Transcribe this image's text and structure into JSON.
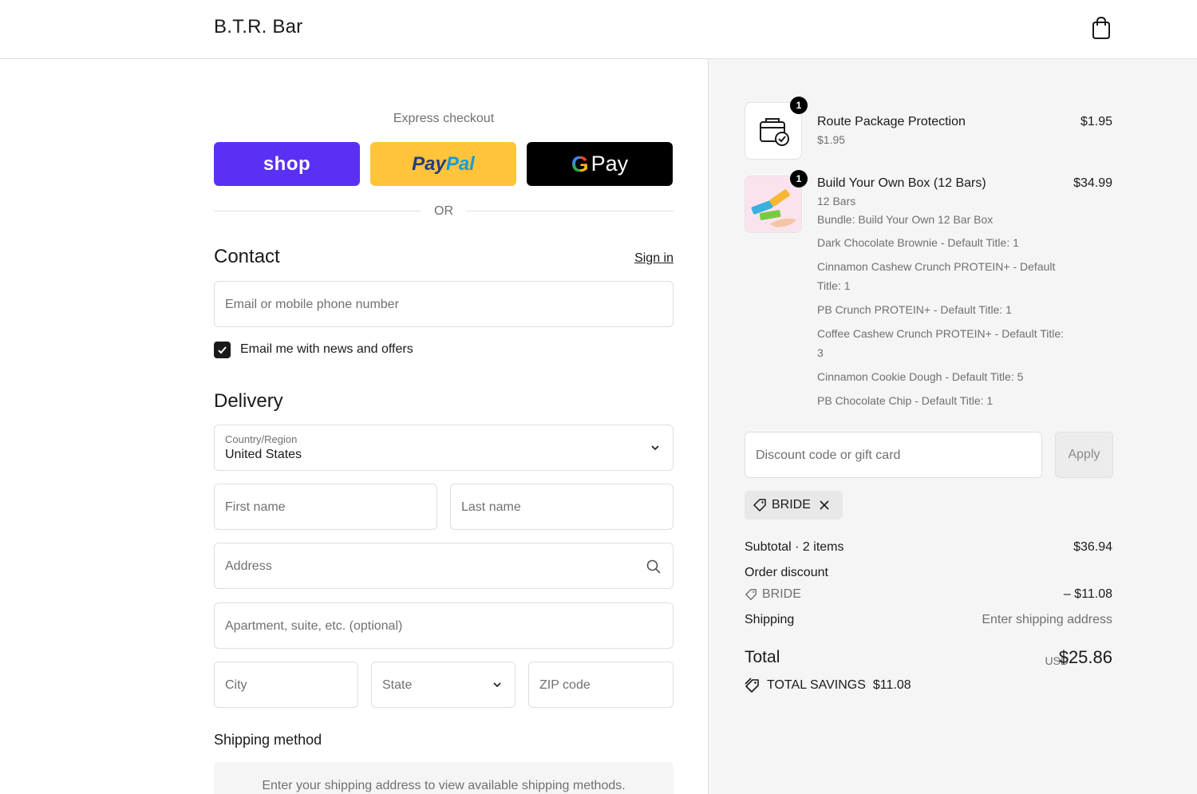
{
  "header": {
    "brand": "B.T.R. Bar",
    "bag_icon": "shopping-bag-icon"
  },
  "express": {
    "title": "Express checkout",
    "shop_label": "shop",
    "paypal_part1": "Pay",
    "paypal_part2": "Pal",
    "gpay_g": "G",
    "gpay_label": "Pay",
    "or_label": "OR"
  },
  "contact": {
    "title": "Contact",
    "sign_in": "Sign in",
    "email_placeholder": "Email or mobile phone number",
    "newsletter_label": "Email me with news and offers",
    "newsletter_checked": true
  },
  "delivery": {
    "title": "Delivery",
    "country_label": "Country/Region",
    "country_value": "United States",
    "first_name_placeholder": "First name",
    "last_name_placeholder": "Last name",
    "address_placeholder": "Address",
    "apartment_placeholder": "Apartment, suite, etc. (optional)",
    "city_placeholder": "City",
    "state_placeholder": "State",
    "zip_placeholder": "ZIP code"
  },
  "shipping_method": {
    "title": "Shipping method",
    "message": "Enter your shipping address to view available shipping methods."
  },
  "summary": {
    "items": [
      {
        "qty": "1",
        "title": "Route Package Protection",
        "subtitle": "$1.95",
        "price": "$1.95",
        "icon": "package-protection-icon"
      },
      {
        "qty": "1",
        "title": "Build Your Own Box (12 Bars)",
        "price": "$34.99",
        "icon": "protein-bars-image",
        "lines": [
          "12 Bars",
          "Bundle: Build Your Own 12 Bar Box",
          "Dark Chocolate Brownie - Default Title: 1",
          "Cinnamon Cashew Crunch PROTEIN+ - Default",
          "Title: 1",
          "PB Crunch PROTEIN+ - Default Title: 1",
          "Coffee Cashew Crunch PROTEIN+ - Default Title:",
          "3",
          "Cinnamon Cookie Dough - Default Title: 5",
          "PB Chocolate Chip - Default Title: 1"
        ]
      }
    ],
    "discount_placeholder": "Discount code or gift card",
    "apply_label": "Apply",
    "applied_code": "BRIDE",
    "subtotal_label": "Subtotal · 2 items",
    "subtotal_value": "$36.94",
    "order_discount_label": "Order discount",
    "discount_code": "BRIDE",
    "discount_value": "– $11.08",
    "shipping_label": "Shipping",
    "shipping_value": "Enter shipping address",
    "total_label": "Total",
    "currency": "USD",
    "total_value": "$25.86",
    "savings_label": "TOTAL SAVINGS",
    "savings_value": "$11.08"
  },
  "colors": {
    "shop_purple": "#5a31f4",
    "paypal_yellow": "#ffc439",
    "gpay_black": "#000000",
    "summary_bg": "#f5f5f5",
    "border": "#dedede"
  }
}
